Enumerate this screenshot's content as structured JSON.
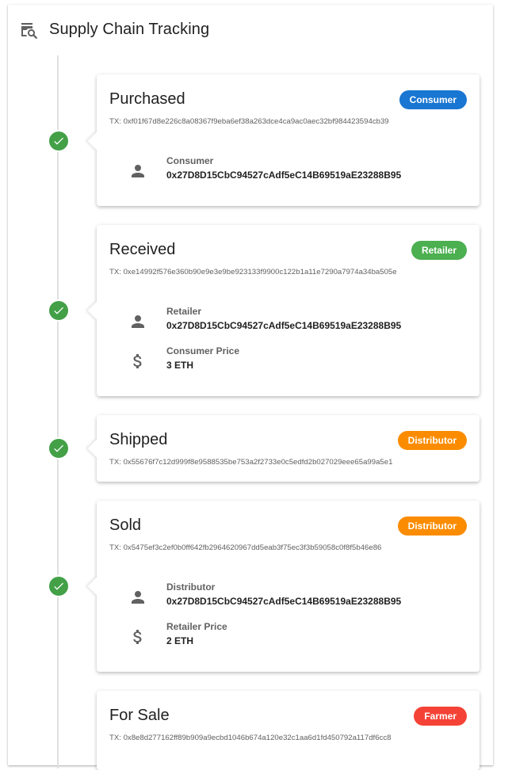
{
  "header": {
    "title": "Supply Chain Tracking",
    "icon": "search-history-icon"
  },
  "colors": {
    "consumer": "#1976d2",
    "retailer": "#4caf50",
    "distributor": "#fb8c00",
    "farmer": "#f44336",
    "check": "#43a047"
  },
  "events": [
    {
      "title": "Purchased",
      "badge": "Consumer",
      "tx": "TX: 0xf01f67d8e226c8a08367f9eba6ef38a263dce4ca9ac0aec32bf984423594cb39",
      "details": [
        {
          "icon": "person-icon",
          "label": "Consumer",
          "value": "0x27D8D15CbC94527cAdf5eC14B69519aE23288B95"
        }
      ]
    },
    {
      "title": "Received",
      "badge": "Retailer",
      "tx": "TX: 0xe14992f576e360b90e9e3e9be923133f9900c122b1a11e7290a7974a34ba505e",
      "details": [
        {
          "icon": "person-icon",
          "label": "Retailer",
          "value": "0x27D8D15CbC94527cAdf5eC14B69519aE23288B95"
        },
        {
          "icon": "dollar-icon",
          "label": "Consumer Price",
          "value": "3 ETH"
        }
      ]
    },
    {
      "title": "Shipped",
      "badge": "Distributor",
      "tx": "TX: 0x55676f7c12d999f8e9588535be753a2f2733e0c5edfd2b027029eee65a99a5e1",
      "details": []
    },
    {
      "title": "Sold",
      "badge": "Distributor",
      "tx": "TX: 0x5475ef3c2ef0b0ff642fb2964620967dd5eab3f75ec3f3b59058c0f8f5b46e86",
      "details": [
        {
          "icon": "person-icon",
          "label": "Distributor",
          "value": "0x27D8D15CbC94527cAdf5eC14B69519aE23288B95"
        },
        {
          "icon": "dollar-icon",
          "label": "Retailer Price",
          "value": "2 ETH"
        }
      ]
    },
    {
      "title": "For Sale",
      "badge": "Farmer",
      "tx": "TX: 0x8e8d277162ff89b909a9ecbd1046b674a120e32c1aa6d1fd450792a117df6cc8",
      "details": []
    }
  ]
}
